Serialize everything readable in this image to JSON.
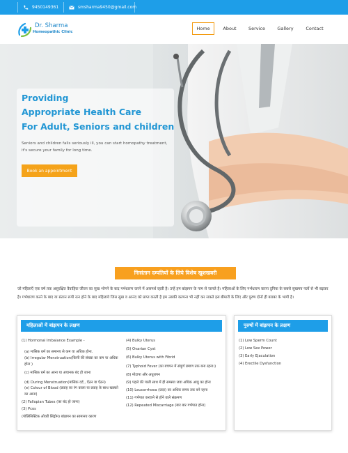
{
  "topbar": {
    "phone": "9450149361",
    "email": "smsharma9450@gmail.com"
  },
  "brand": {
    "name": "Dr. Sharma",
    "subtitle": "Homeopathic Clinic"
  },
  "nav": [
    "Home",
    "About",
    "Service",
    "Gallery",
    "Contact"
  ],
  "hero": {
    "title_lines": [
      "Providing",
      "Appropriate Health Care",
      "For Adult, Seniors and children"
    ],
    "text": "Seniors and children falls seriously ill, you can start homopathy treatment, it's secure your family for long time.",
    "button": "Book an appointment"
  },
  "section": {
    "banner": "निःसंतान दम्पतियों के लिये विशेष खुशखबरी",
    "intro": "जो महिलाएँ एक वर्ष तक असुरक्षित वैवाहिक जीवन का सुख भोगने के बाद गर्भधारण करने में असमर्थ रहती है। उन्हें हम बांझपन के नाम से जानते है। महिलाओं के लिए गर्भधारण करना दुनिया के सबसे सुखमय पलों से भी बढ़कर है। गर्भधारण करने के बाद या संतान रूपी रत्न होने के बाद महिलाये जिस सुख व आनंद को प्राप्त करती है हम उसकी कल्पना भी नहीं कर सकते इस बीमारी के लिए और पुरुष दोनों ही बराबर के भागी है।"
  },
  "women": {
    "heading": "महिलाओं में बांझपन के लक्षण",
    "col1": [
      "(1) Hormonal Imbalance Example -",
      "(a) मासिक धर्म का समानय से कम या अधिक होना.",
      "(b) Irregular Menstruation(किसी की संख्या का कम या अधिक होना )",
      "(c) मासिक धर्म का आना या अचानक बंद हो जाना",
      "(d) During Menstruation(मासिक दर्द , ऐंठन या ऐंठन)",
      "(e) Colour of Blood (प्रवाह का रंग काला या प्रवाह के साथ खक्को का आना)",
      "(2) Fallopian Tubes (का बंद हो जाना)",
      "(3) Pcos",
      "(पॉलिसिस्टिक ओवरी सिंड्रोम) बांझपन का सामानय कारण"
    ],
    "col2": [
      "(4) Bulky Uterus",
      "(5) Ovarian Cyst",
      "(6) Bulky Uterus with Fibrid",
      "(7) Typhoid Fever (का बचपन में संपूर्ण प्रमाण तक बना रहना।)",
      "(8) मोटापा और अधूरापन",
      "(9) पहले की पाली साथ में ही समस्या जवा अधिक आयु का होना",
      "(10) Leucorrhoea (प्रदर) का अधिक समय तक बने रहना",
      "(11) गर्भपात करवाने से होने वाले संक्रमण",
      "(12) Repeated Miscarriage (बार बार गर्भपात होना)"
    ]
  },
  "men": {
    "heading": "पुरुषों में बांझपन के लक्षण",
    "items": [
      "(1) Low Sperm Count",
      "(2) Low Sex Power",
      "(3) Early Ejaculation",
      "(4) Erectile Dysfunction"
    ]
  }
}
